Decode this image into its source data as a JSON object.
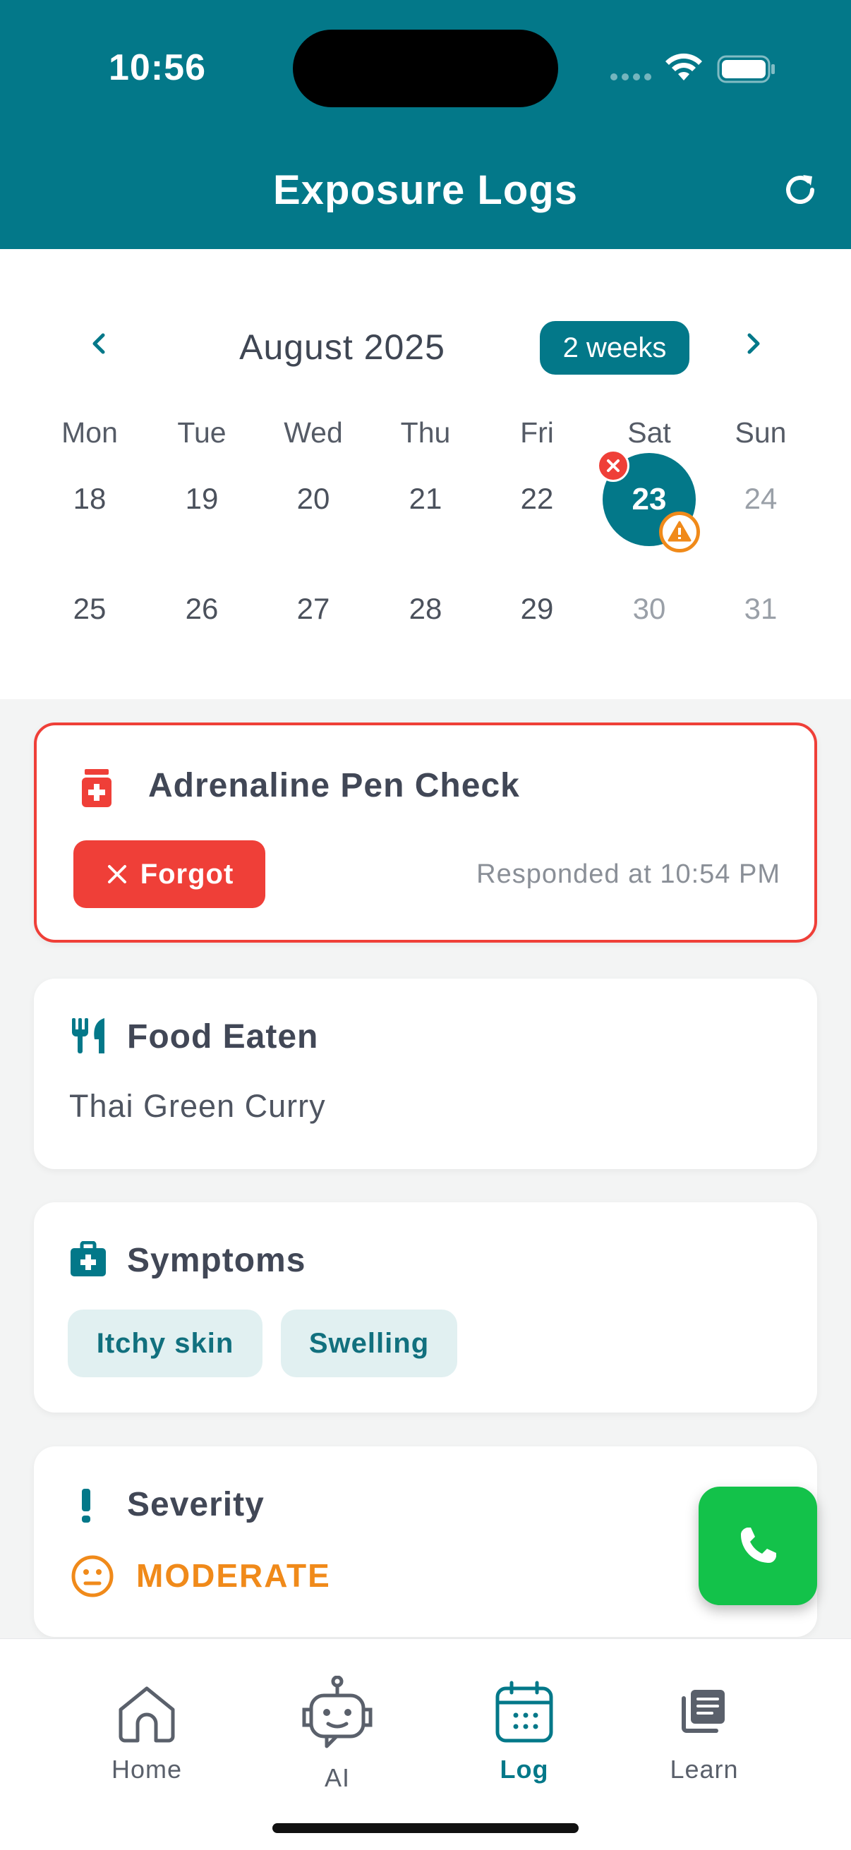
{
  "status_bar": {
    "time": "10:56"
  },
  "header": {
    "title": "Exposure Logs",
    "refresh_icon": "refresh-icon"
  },
  "calendar": {
    "month": "August 2025",
    "range_label": "2 weeks",
    "weekdays": [
      "Mon",
      "Tue",
      "Wed",
      "Thu",
      "Fri",
      "Sat",
      "Sun"
    ],
    "week1": [
      "18",
      "19",
      "20",
      "21",
      "22",
      "23",
      "24"
    ],
    "week2": [
      "25",
      "26",
      "27",
      "28",
      "29",
      "30",
      "31"
    ],
    "selected_day": "23"
  },
  "alert_card": {
    "title": "Adrenaline Pen Check",
    "status_label": "Forgot",
    "responded": "Responded at 10:54 PM",
    "accent": "#ef3f38"
  },
  "food_card": {
    "title": "Food Eaten",
    "value": "Thai Green Curry"
  },
  "symptoms_card": {
    "title": "Symptoms",
    "chips": [
      "Itchy skin",
      "Swelling"
    ]
  },
  "severity_card": {
    "title": "Severity",
    "value": "MODERATE",
    "color": "#f08a1a"
  },
  "fab": {
    "icon": "phone-icon",
    "color": "#13c24a"
  },
  "bottom_nav": {
    "items": [
      {
        "label": "Home",
        "icon": "home-icon"
      },
      {
        "label": "AI",
        "icon": "robot-icon"
      },
      {
        "label": "Log",
        "icon": "calendar-icon",
        "active": true
      },
      {
        "label": "Learn",
        "icon": "book-icon"
      }
    ]
  },
  "colors": {
    "primary": "#037889",
    "danger": "#ef3f38",
    "warning": "#f08a1a",
    "success": "#13c24a"
  }
}
